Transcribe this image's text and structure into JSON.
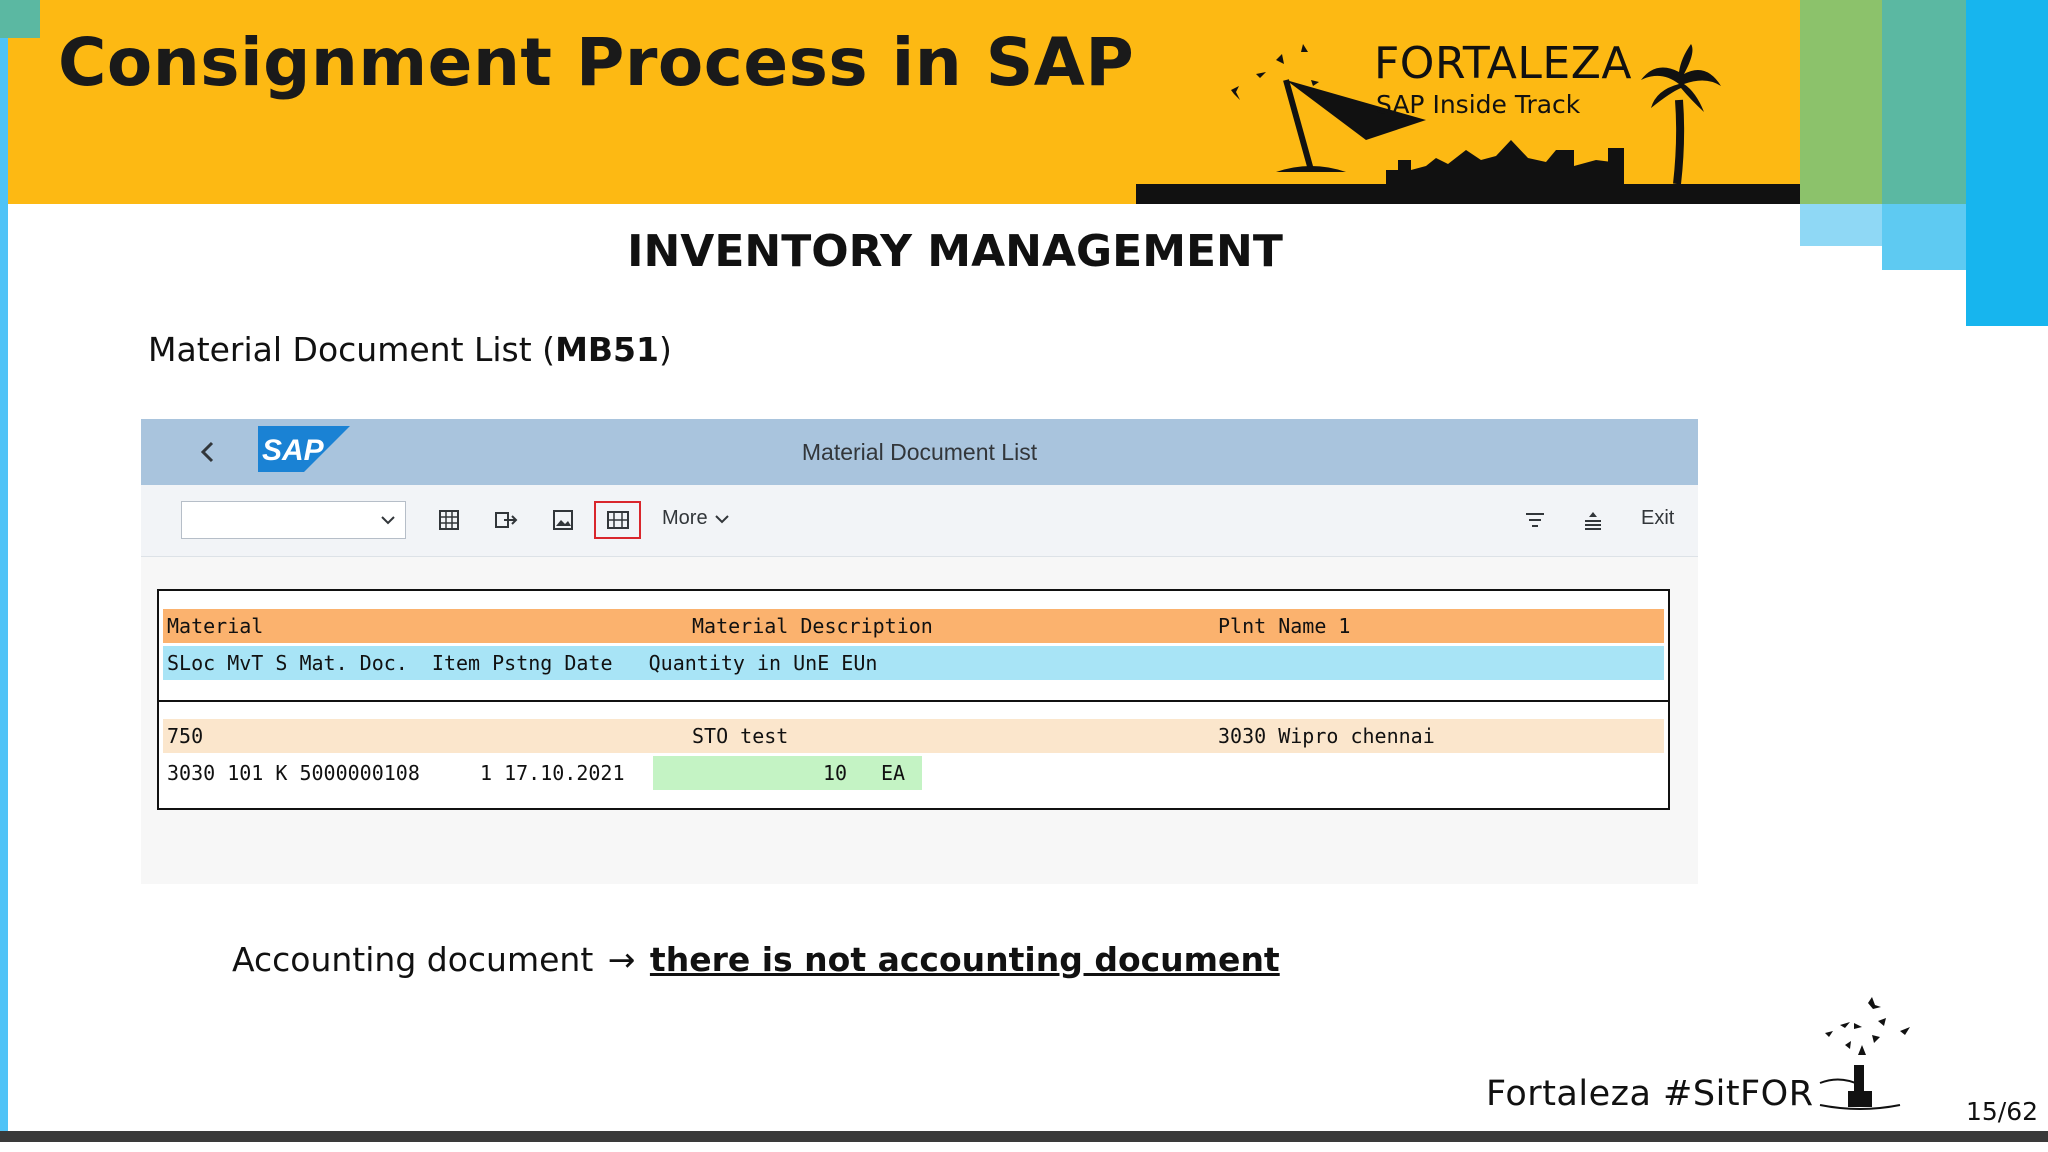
{
  "slide": {
    "title": "Consignment Process in SAP",
    "banner_title": "FORTALEZA",
    "banner_subtitle": "SAP Inside Track",
    "section_heading": "INVENTORY MANAGEMENT",
    "doc_label_prefix": "Material Document List (",
    "doc_label_code": "MB51",
    "doc_label_suffix": ")",
    "accounting_label": "Accounting document",
    "accounting_arrow": "→",
    "accounting_value": "there is not accounting document",
    "footer_tag": "Fortaleza #SitFOR",
    "page_number": "15/62"
  },
  "sap_window": {
    "logo_text": "SAP",
    "title": "Material Document List",
    "toolbar": {
      "variant_select_value": "",
      "icons": [
        "table-icon",
        "transfer-icon",
        "image-icon",
        "layout-icon"
      ],
      "selected_icon": "layout-icon",
      "more_label": "More",
      "filter_icon": "filter-icon",
      "sort_icon": "sort-icon",
      "exit_label": "Exit"
    },
    "list": {
      "header_row_1": {
        "material": "Material",
        "description": "Material Description",
        "plant": "Plnt Name 1"
      },
      "header_row_2": {
        "text": "SLoc MvT S Mat. Doc.  Item Pstng Date   Quantity in UnE EUn"
      },
      "data_row_1": {
        "material": "750",
        "description": "STO test",
        "plant": "3030 Wipro chennai"
      },
      "data_row_2": {
        "sloc_mvt": "3030 101 K 5000000108",
        "item_date": "1 17.10.2021",
        "quantity": "10",
        "unit": "EA"
      }
    }
  },
  "colors": {
    "header_band": "#fdb913",
    "sap_titlebar": "#a9c4dd",
    "list_header_1": "#fbb26e",
    "list_header_2": "#a8e4f6",
    "list_data_1": "#fbe6cc",
    "quantity_highlight": "#c4f3c4",
    "selected_icon_border": "#d9262c"
  }
}
